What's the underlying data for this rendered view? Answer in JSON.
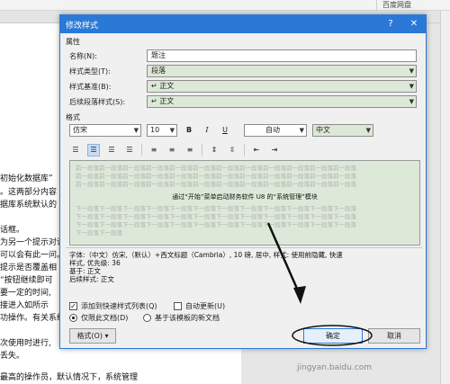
{
  "background": {
    "tab_label": "百度网盘",
    "doc_lines": [
      "话框。",
      "为另一个提示对话",
      "可以会有此一问。",
      "提示是否覆盖相",
      "“按钮继续即可",
      "要一定的时间,",
      "接进入如所示",
      "功操作。有关系统",
      "次使用时进行,",
      "丢失。",
      "最高的操作员，默认情况下，系统管理"
    ],
    "doc_lines_top": [
      "初始化数据库”",
      "。这两部分内容",
      "据库系统默认的"
    ],
    "red_fragment": "如所示"
  },
  "dialog": {
    "title": "修改样式",
    "help_icon": "?",
    "close_icon": "✕",
    "properties_label": "属性",
    "fields": [
      {
        "label": "名称(N):",
        "value": "题注"
      },
      {
        "label": "样式类型(T):",
        "value": "段落"
      },
      {
        "label": "样式基准(B):",
        "value": "↵ 正文"
      },
      {
        "label": "后续段落样式(S):",
        "value": "↵ 正文"
      }
    ],
    "format_label": "格式",
    "font": "仿宋",
    "size": "10",
    "bold": "B",
    "italic": "I",
    "underline": "U",
    "color": "自动",
    "lang": "中文",
    "preview": {
      "gray_before": "前一段落前一段落前一段落前一段落前一段落前一段落前一段落前一段落前一段落前一段落前一段落前一段落",
      "sample": "通过“开始”菜单启动财务软件 U8 的“系统管理”模块",
      "gray_after": "下一段落下一段落下一段落下一段落下一段落下一段落下一段落下一段落下一段落下一段落下一段落下一段落",
      "gray_end": "下一段落下一段落"
    },
    "description": [
      "字体:（中文）仿宋,（默认）+西文标题（Cambria）, 10 磅, 居中, 样式: 使用前隐藏, 快速",
      "样式, 优先级: 36",
      "    基于: 正文",
      "    后续样式: 正文"
    ],
    "add_to_gallery": "添加到快速样式列表(Q)",
    "auto_update": "自动更新(U)",
    "only_this_doc": "仅限此文档(D)",
    "new_template_docs": "基于该模板的新文档",
    "format_button": "格式(O) ▾",
    "ok_button": "确定",
    "cancel_button": "取消"
  },
  "watermark": "jingyan.baidu.com"
}
